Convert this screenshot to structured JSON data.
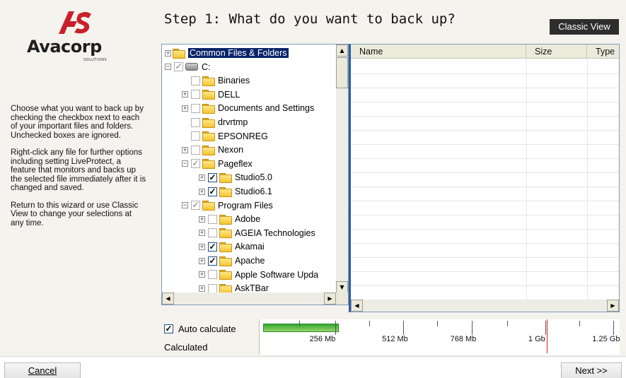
{
  "brand": {
    "name": "Avacorp",
    "tagline": "SOLUTIONS",
    "logo_color": "#c8202a"
  },
  "title": "Step 1: What do you want to back up?",
  "classic_view_label": "Classic View",
  "help": {
    "p1": "Choose what you want to back up by checking the checkbox next to each of your important files and folders. Unchecked boxes are ignored.",
    "p2": "Right-click any file for further options including setting LiveProtect, a feature that monitors and backs up the selected file immediately after it is changed and saved.",
    "p3": "Return to this wizard or use Classic View to change your selections at any time."
  },
  "tree": [
    {
      "label": "Common Files & Folders",
      "level": 0,
      "expander": "+",
      "check": "none",
      "icon": "folder-open-icon",
      "selected": true
    },
    {
      "label": "C:",
      "level": 0,
      "expander": "-",
      "check": "partial",
      "icon": "drive-icon"
    },
    {
      "label": "Binaries",
      "level": 1,
      "expander": "",
      "check": "off",
      "icon": "folder-icon"
    },
    {
      "label": "DELL",
      "level": 1,
      "expander": "+",
      "check": "off",
      "icon": "folder-icon"
    },
    {
      "label": "Documents and Settings",
      "level": 1,
      "expander": "+",
      "check": "off",
      "icon": "folder-icon"
    },
    {
      "label": "drvrtmp",
      "level": 1,
      "expander": "",
      "check": "off",
      "icon": "folder-icon"
    },
    {
      "label": "EPSONREG",
      "level": 1,
      "expander": "",
      "check": "off",
      "icon": "folder-icon"
    },
    {
      "label": "Nexon",
      "level": 1,
      "expander": "+",
      "check": "off",
      "icon": "folder-icon"
    },
    {
      "label": "Pageflex",
      "level": 1,
      "expander": "-",
      "check": "partial",
      "icon": "folder-icon"
    },
    {
      "label": "Studio5.0",
      "level": 2,
      "expander": "+",
      "check": "on",
      "icon": "folder-icon"
    },
    {
      "label": "Studio6.1",
      "level": 2,
      "expander": "+",
      "check": "on",
      "icon": "folder-icon"
    },
    {
      "label": "Program Files",
      "level": 1,
      "expander": "-",
      "check": "partial",
      "icon": "folder-icon"
    },
    {
      "label": "Adobe",
      "level": 2,
      "expander": "+",
      "check": "off",
      "icon": "folder-icon"
    },
    {
      "label": "AGEIA Technologies",
      "level": 2,
      "expander": "+",
      "check": "off",
      "icon": "folder-icon"
    },
    {
      "label": "Akamai",
      "level": 2,
      "expander": "+",
      "check": "on",
      "icon": "folder-icon"
    },
    {
      "label": "Apache",
      "level": 2,
      "expander": "+",
      "check": "on",
      "icon": "folder-icon"
    },
    {
      "label": "Apple Software Upda",
      "level": 2,
      "expander": "+",
      "check": "off",
      "icon": "folder-icon"
    },
    {
      "label": "AskTBar",
      "level": 2,
      "expander": "+",
      "check": "off",
      "icon": "folder-icon"
    }
  ],
  "file_list": {
    "columns": [
      "Name",
      "Size",
      "Type"
    ]
  },
  "auto_calculate": {
    "label": "Auto calculate",
    "checked": true
  },
  "calculated_label": "Calculated",
  "gauge": {
    "labels": [
      "256 Mb",
      "512 Mb",
      "768 Mb",
      "1 Gb",
      "1.25 Gb"
    ],
    "used_fraction": 0.21,
    "fill_color": "#2fa82f",
    "marker_color": "#e02020"
  },
  "footer": {
    "cancel_label": "Cancel",
    "next_label": "Next >>"
  }
}
